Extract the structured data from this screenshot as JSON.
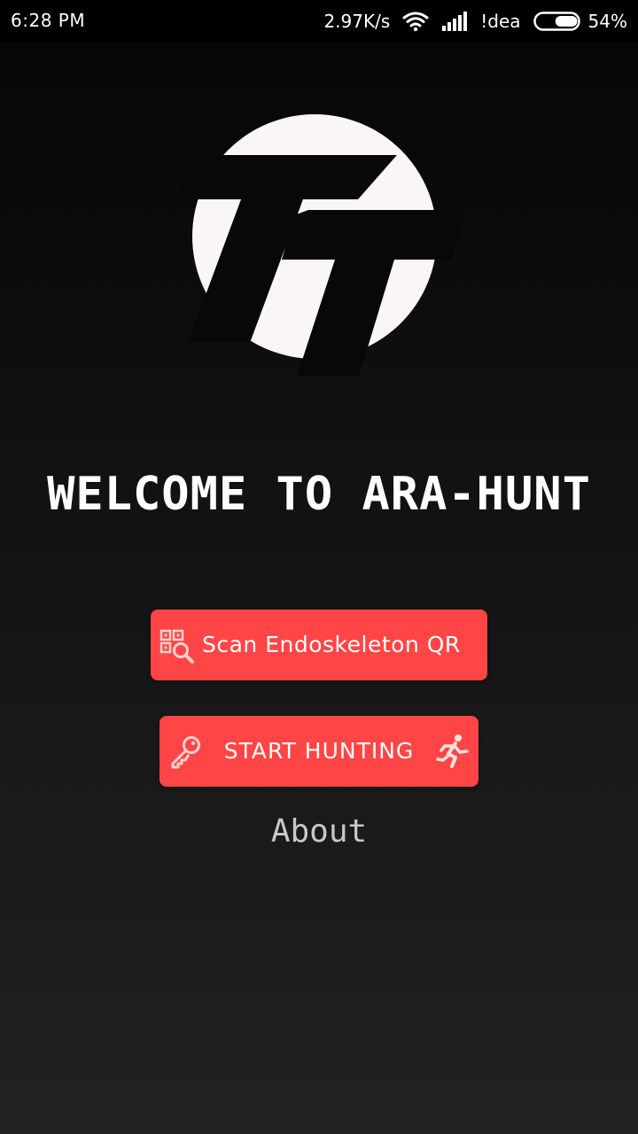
{
  "status_bar": {
    "time": "6:28 PM",
    "network_speed": "2.97K/s",
    "carrier": "!dea",
    "battery_percent": "54%",
    "battery_level": 0.54,
    "icons": [
      "wifi-icon",
      "signal-icon",
      "battery-icon"
    ]
  },
  "logo": {
    "icon": "tt-logo"
  },
  "welcome": {
    "title": "WELCOME TO ARA-HUNT"
  },
  "buttons": {
    "scan_label": "Scan Endoskeleton QR",
    "scan_icon": "qr-search-icon",
    "hunt_label": "START HUNTING",
    "hunt_left_icon": "key-icon",
    "hunt_right_icon": "running-person-icon"
  },
  "about": {
    "label": "About"
  },
  "colors": {
    "accent": "#ff4545",
    "background_top": "#050505",
    "background_bottom": "#222222",
    "text": "#ffffff",
    "muted_text": "#c8c8c8"
  }
}
